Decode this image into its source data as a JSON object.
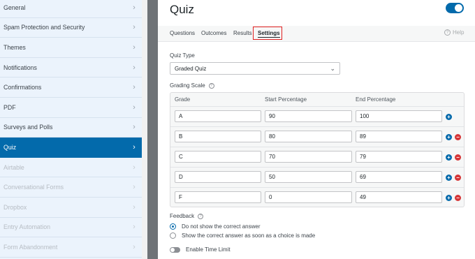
{
  "sidebar": {
    "items": [
      {
        "label": "General",
        "state": "normal"
      },
      {
        "label": "Spam Protection and Security",
        "state": "normal"
      },
      {
        "label": "Themes",
        "state": "normal"
      },
      {
        "label": "Notifications",
        "state": "normal"
      },
      {
        "label": "Confirmations",
        "state": "normal"
      },
      {
        "label": "PDF",
        "state": "normal"
      },
      {
        "label": "Surveys and Polls",
        "state": "normal"
      },
      {
        "label": "Quiz",
        "state": "active"
      },
      {
        "label": "Airtable",
        "state": "disabled"
      },
      {
        "label": "Conversational Forms",
        "state": "disabled"
      },
      {
        "label": "Dropbox",
        "state": "disabled"
      },
      {
        "label": "Entry Automation",
        "state": "disabled"
      },
      {
        "label": "Form Abandonment",
        "state": "disabled"
      }
    ],
    "chevron_glyph": "›"
  },
  "header": {
    "title": "Quiz",
    "enabled": true
  },
  "tabs": {
    "items": [
      "Questions",
      "Outcomes",
      "Results",
      "Settings"
    ],
    "active": "Settings",
    "help_label": "Help"
  },
  "quiz_type": {
    "label": "Quiz Type",
    "value": "Graded Quiz"
  },
  "grading_scale": {
    "label": "Grading Scale",
    "columns": [
      "Grade",
      "Start Percentage",
      "End Percentage"
    ],
    "rows": [
      {
        "grade": "A",
        "start": "90",
        "end": "100",
        "removable": false
      },
      {
        "grade": "B",
        "start": "80",
        "end": "89",
        "removable": true
      },
      {
        "grade": "C",
        "start": "70",
        "end": "79",
        "removable": true
      },
      {
        "grade": "D",
        "start": "50",
        "end": "69",
        "removable": true
      },
      {
        "grade": "F",
        "start": "0",
        "end": "49",
        "removable": true
      }
    ]
  },
  "feedback": {
    "label": "Feedback",
    "options": [
      {
        "label": "Do not show the correct answer",
        "checked": true
      },
      {
        "label": "Show the correct answer as soon as a choice is made",
        "checked": false
      }
    ]
  },
  "time_limit": {
    "label": "Enable Time Limit",
    "enabled": false
  },
  "colors": {
    "accent": "#036aab",
    "danger": "#d63638",
    "highlight_box": "#e02020"
  }
}
